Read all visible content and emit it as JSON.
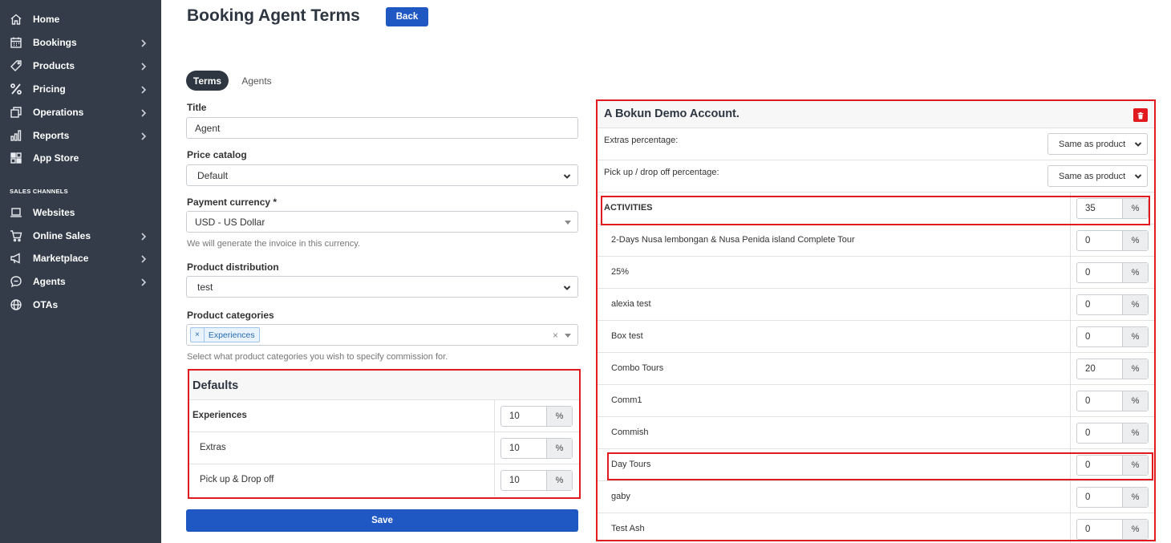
{
  "sidebar": {
    "items": [
      {
        "label": "Home",
        "icon": "home-icon",
        "chevron": false
      },
      {
        "label": "Bookings",
        "icon": "calendar-icon",
        "chevron": true
      },
      {
        "label": "Products",
        "icon": "tag-icon",
        "chevron": true
      },
      {
        "label": "Pricing",
        "icon": "percent-icon",
        "chevron": true
      },
      {
        "label": "Operations",
        "icon": "copy-icon",
        "chevron": true
      },
      {
        "label": "Reports",
        "icon": "bar-chart-icon",
        "chevron": true
      },
      {
        "label": "App Store",
        "icon": "grid-icon",
        "chevron": false
      }
    ],
    "section_label": "SALES CHANNELS",
    "channel_items": [
      {
        "label": "Websites",
        "icon": "laptop-icon",
        "chevron": false
      },
      {
        "label": "Online Sales",
        "icon": "cart-icon",
        "chevron": true
      },
      {
        "label": "Marketplace",
        "icon": "megaphone-icon",
        "chevron": true
      },
      {
        "label": "Agents",
        "icon": "chat-icon",
        "chevron": true
      },
      {
        "label": "OTAs",
        "icon": "globe-icon",
        "chevron": false
      }
    ]
  },
  "header": {
    "title": "Booking Agent Terms",
    "back_label": "Back"
  },
  "tabs": [
    {
      "label": "Terms",
      "active": true
    },
    {
      "label": "Agents",
      "active": false
    }
  ],
  "form": {
    "title_label": "Title",
    "title_value": "Agent",
    "price_catalog_label": "Price catalog",
    "price_catalog_value": "Default",
    "payment_currency_label": "Payment currency *",
    "payment_currency_value": "USD - US Dollar",
    "payment_currency_help": "We will generate the invoice in this currency.",
    "product_distribution_label": "Product distribution",
    "product_distribution_value": "test",
    "product_categories_label": "Product categories",
    "product_categories_tag": "Experiences",
    "product_categories_help": "Select what product categories you wish to specify commission for.",
    "save_label": "Save"
  },
  "defaults": {
    "title": "Defaults",
    "rows": [
      {
        "label": "Experiences",
        "value": "10",
        "bold": true
      },
      {
        "label": "Extras",
        "value": "10",
        "bold": false
      },
      {
        "label": "Pick up & Drop off",
        "value": "10",
        "bold": false
      }
    ],
    "pct_symbol": "%"
  },
  "account": {
    "title": "A Bokun Demo Account.",
    "extras_label": "Extras percentage:",
    "extras_value": "Same as product",
    "pickup_label": "Pick up / drop off percentage:",
    "pickup_value": "Same as product",
    "category_label": "ACTIVITIES",
    "category_value": "35",
    "products": [
      {
        "label": "2-Days Nusa lembongan & Nusa Penida island Complete Tour",
        "value": "0"
      },
      {
        "label": "25%",
        "value": "0"
      },
      {
        "label": "alexia test",
        "value": "0"
      },
      {
        "label": "Box test",
        "value": "0"
      },
      {
        "label": "Combo Tours",
        "value": "20"
      },
      {
        "label": "Comm1",
        "value": "0"
      },
      {
        "label": "Commish",
        "value": "0"
      },
      {
        "label": "Day Tours",
        "value": "0"
      },
      {
        "label": "gaby",
        "value": "0"
      },
      {
        "label": "Test Ash",
        "value": "0"
      }
    ]
  },
  "colors": {
    "sidebar_bg": "#333c48",
    "primary": "#1f57c3",
    "danger": "#e01a1f",
    "highlight": "#e01a1f"
  }
}
